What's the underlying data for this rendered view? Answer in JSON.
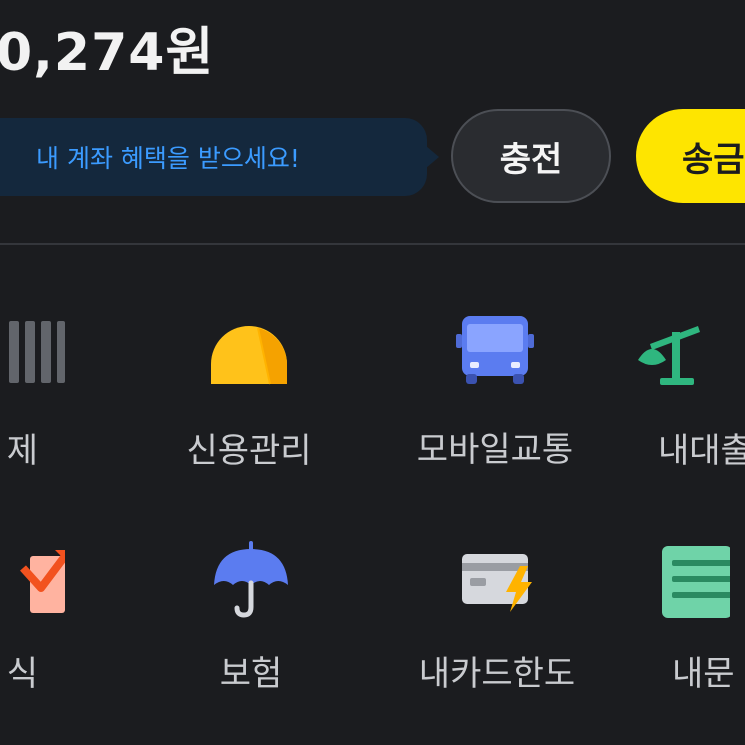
{
  "account": {
    "balance": "0,274원"
  },
  "promo": {
    "text": "내 계좌 혜택을 받으세요!"
  },
  "actions": {
    "charge_label": "충전",
    "send_label": "송금"
  },
  "menu": [
    {
      "label": "제",
      "icon": "barcode-icon"
    },
    {
      "label": "신용관리",
      "icon": "credit-score-icon"
    },
    {
      "label": "모바일교통",
      "icon": "bus-icon"
    },
    {
      "label": "내대출",
      "icon": "loan-scale-icon"
    },
    {
      "label": "식",
      "icon": "stock-chart-icon"
    },
    {
      "label": "보험",
      "icon": "umbrella-icon"
    },
    {
      "label": "내카드한도",
      "icon": "card-limit-icon"
    },
    {
      "label": "내문",
      "icon": "document-icon"
    }
  ],
  "colors": {
    "background": "#1b1c1f",
    "accent_yellow": "#fee500",
    "tooltip_bg": "#14283d",
    "tooltip_text": "#3b9bff"
  }
}
